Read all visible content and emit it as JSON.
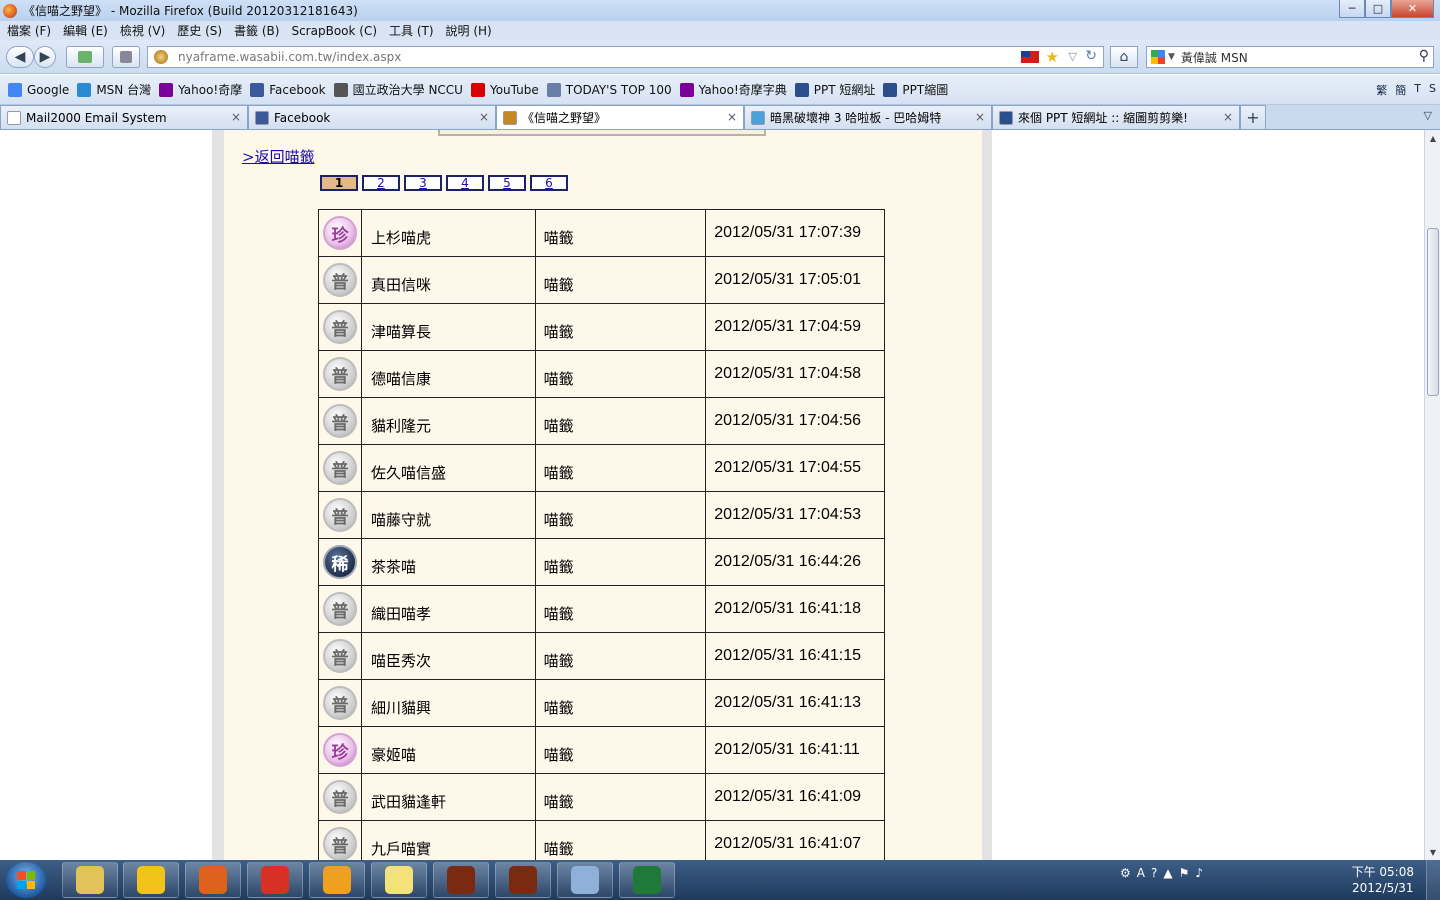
{
  "window": {
    "title": "《信喵之野望》 - Mozilla Firefox (Build 20120312181643)",
    "min": "─",
    "max": "□",
    "close": "✕"
  },
  "menu": [
    "檔案 (F)",
    "編輯 (E)",
    "檢視 (V)",
    "歷史 (S)",
    "書籤 (B)",
    "ScrapBook (C)",
    "工具 (T)",
    "說明 (H)"
  ],
  "nav": {
    "back": "◀",
    "forward": "▶",
    "url": "nyaframe.wasabii.com.tw/index.aspx",
    "search_value": "黃偉誠 MSN",
    "home": "⌂"
  },
  "bookmarks": [
    {
      "label": "Google",
      "icon": "google-icon",
      "color": "#4285f4"
    },
    {
      "label": "MSN 台灣",
      "icon": "msn-icon",
      "color": "#2a8ad4"
    },
    {
      "label": "Yahoo!奇摩",
      "icon": "yahoo-icon",
      "color": "#7b0099"
    },
    {
      "label": "Facebook",
      "icon": "facebook-icon",
      "color": "#3b5998"
    },
    {
      "label": "國立政治大學 NCCU",
      "icon": "nccu-icon",
      "color": "#555555"
    },
    {
      "label": "YouTube",
      "icon": "youtube-icon",
      "color": "#d90000"
    },
    {
      "label": "TODAY'S TOP 100",
      "icon": "top100-icon",
      "color": "#6a7fa8"
    },
    {
      "label": "Yahoo!奇摩字典",
      "icon": "yahoo-icon",
      "color": "#7b0099"
    },
    {
      "label": "PPT 短網址",
      "icon": "ppt-icon",
      "color": "#2b4f8a"
    },
    {
      "label": "PPT縮圖",
      "icon": "ppt-icon",
      "color": "#2b4f8a"
    }
  ],
  "bookmarks_right": [
    "繁",
    "簡",
    "T",
    "S"
  ],
  "tabs": [
    {
      "label": "Mail2000 Email System",
      "color": "#ffffff",
      "active": false
    },
    {
      "label": "Facebook",
      "color": "#3b5998",
      "active": false
    },
    {
      "label": "《信喵之野望》",
      "color": "#c58a1f",
      "active": true
    },
    {
      "label": "暗黑破壞神 3 哈啦板 - 巴哈姆特",
      "color": "#4aa0d8",
      "active": false
    },
    {
      "label": "來個 PPT 短網址 :: 縮圖剪剪樂!",
      "color": "#2b4f8a",
      "active": false
    }
  ],
  "tab_close": "×",
  "new_tab": "+",
  "page": {
    "back_link": ">返回喵籤",
    "pages": [
      "1",
      "2",
      "3",
      "4",
      "5",
      "6"
    ],
    "current_page": "1"
  },
  "rows": [
    {
      "rank": "珍",
      "rank_type": "rare",
      "name": "上杉喵虎",
      "type": "喵籤",
      "time": "2012/05/31 17:07:39"
    },
    {
      "rank": "普",
      "rank_type": "common",
      "name": "真田信咪",
      "type": "喵籤",
      "time": "2012/05/31 17:05:01"
    },
    {
      "rank": "普",
      "rank_type": "common",
      "name": "津喵算長",
      "type": "喵籤",
      "time": "2012/05/31 17:04:59"
    },
    {
      "rank": "普",
      "rank_type": "common",
      "name": "德喵信康",
      "type": "喵籤",
      "time": "2012/05/31 17:04:58"
    },
    {
      "rank": "普",
      "rank_type": "common",
      "name": "貓利隆元",
      "type": "喵籤",
      "time": "2012/05/31 17:04:56"
    },
    {
      "rank": "普",
      "rank_type": "common",
      "name": "佐久喵信盛",
      "type": "喵籤",
      "time": "2012/05/31 17:04:55"
    },
    {
      "rank": "普",
      "rank_type": "common",
      "name": "喵藤守就",
      "type": "喵籤",
      "time": "2012/05/31 17:04:53"
    },
    {
      "rank": "稀",
      "rank_type": "dark",
      "name": "茶茶喵",
      "type": "喵籤",
      "time": "2012/05/31 16:44:26"
    },
    {
      "rank": "普",
      "rank_type": "common",
      "name": "織田喵孝",
      "type": "喵籤",
      "time": "2012/05/31 16:41:18"
    },
    {
      "rank": "普",
      "rank_type": "common",
      "name": "喵臣秀次",
      "type": "喵籤",
      "time": "2012/05/31 16:41:15"
    },
    {
      "rank": "普",
      "rank_type": "common",
      "name": "細川貓興",
      "type": "喵籤",
      "time": "2012/05/31 16:41:13"
    },
    {
      "rank": "珍",
      "rank_type": "rare",
      "name": "豪姬喵",
      "type": "喵籤",
      "time": "2012/05/31 16:41:11"
    },
    {
      "rank": "普",
      "rank_type": "common",
      "name": "武田貓逢軒",
      "type": "喵籤",
      "time": "2012/05/31 16:41:09"
    },
    {
      "rank": "普",
      "rank_type": "common",
      "name": "九戶喵實",
      "type": "喵籤",
      "time": "2012/05/31 16:41:07"
    }
  ],
  "taskbar": {
    "apps": [
      {
        "name": "file-explorer-icon",
        "color": "#e3c25a"
      },
      {
        "name": "app-k-icon",
        "color": "#f2c41a"
      },
      {
        "name": "firefox-icon",
        "color": "#e0601e"
      },
      {
        "name": "chrome-icon",
        "color": "#d93025"
      },
      {
        "name": "app-smiley-icon",
        "color": "#f0a020"
      },
      {
        "name": "folder-icon",
        "color": "#f3e27a"
      },
      {
        "name": "diablo-icon",
        "color": "#7a2a10"
      },
      {
        "name": "diablo-icon",
        "color": "#7a2a10"
      },
      {
        "name": "calculator-icon",
        "color": "#8fb0d8"
      },
      {
        "name": "excel-icon",
        "color": "#1f7a3a"
      }
    ],
    "clock_time": "下午 05:08",
    "clock_date": "2012/5/31"
  }
}
